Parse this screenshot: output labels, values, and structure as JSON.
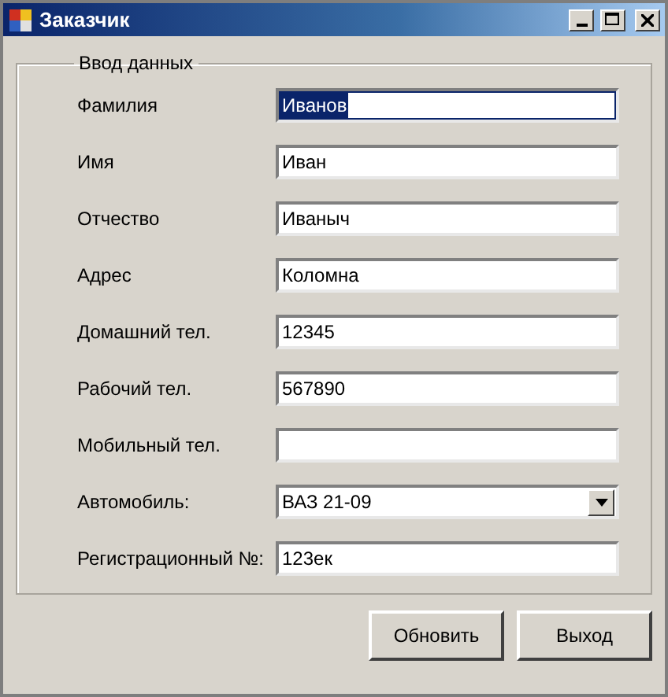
{
  "window": {
    "title": "Заказчик"
  },
  "group": {
    "title": "Ввод данных"
  },
  "fields": [
    {
      "label": "Фамилия",
      "kind": "text",
      "value": "Иванов",
      "highlighted": true
    },
    {
      "label": "Имя",
      "kind": "text",
      "value": "Иван",
      "highlighted": false
    },
    {
      "label": "Отчество",
      "kind": "text",
      "value": "Иваныч",
      "highlighted": false
    },
    {
      "label": "Адрес",
      "kind": "text",
      "value": "Коломна",
      "highlighted": false
    },
    {
      "label": "Домашний тел.",
      "kind": "text",
      "value": "12345",
      "highlighted": false
    },
    {
      "label": "Рабочий тел.",
      "kind": "text",
      "value": "567890",
      "highlighted": false
    },
    {
      "label": "Мобильный тел.",
      "kind": "text",
      "highlighted": false
    },
    {
      "label": "Автомобиль:",
      "kind": "dropdown",
      "value": "ВАЗ 21-09"
    },
    {
      "label": "Регистрационный №:",
      "kind": "text",
      "value": "123ек",
      "highlighted": false
    }
  ],
  "buttons": [
    "Обновить",
    "Выход"
  ]
}
